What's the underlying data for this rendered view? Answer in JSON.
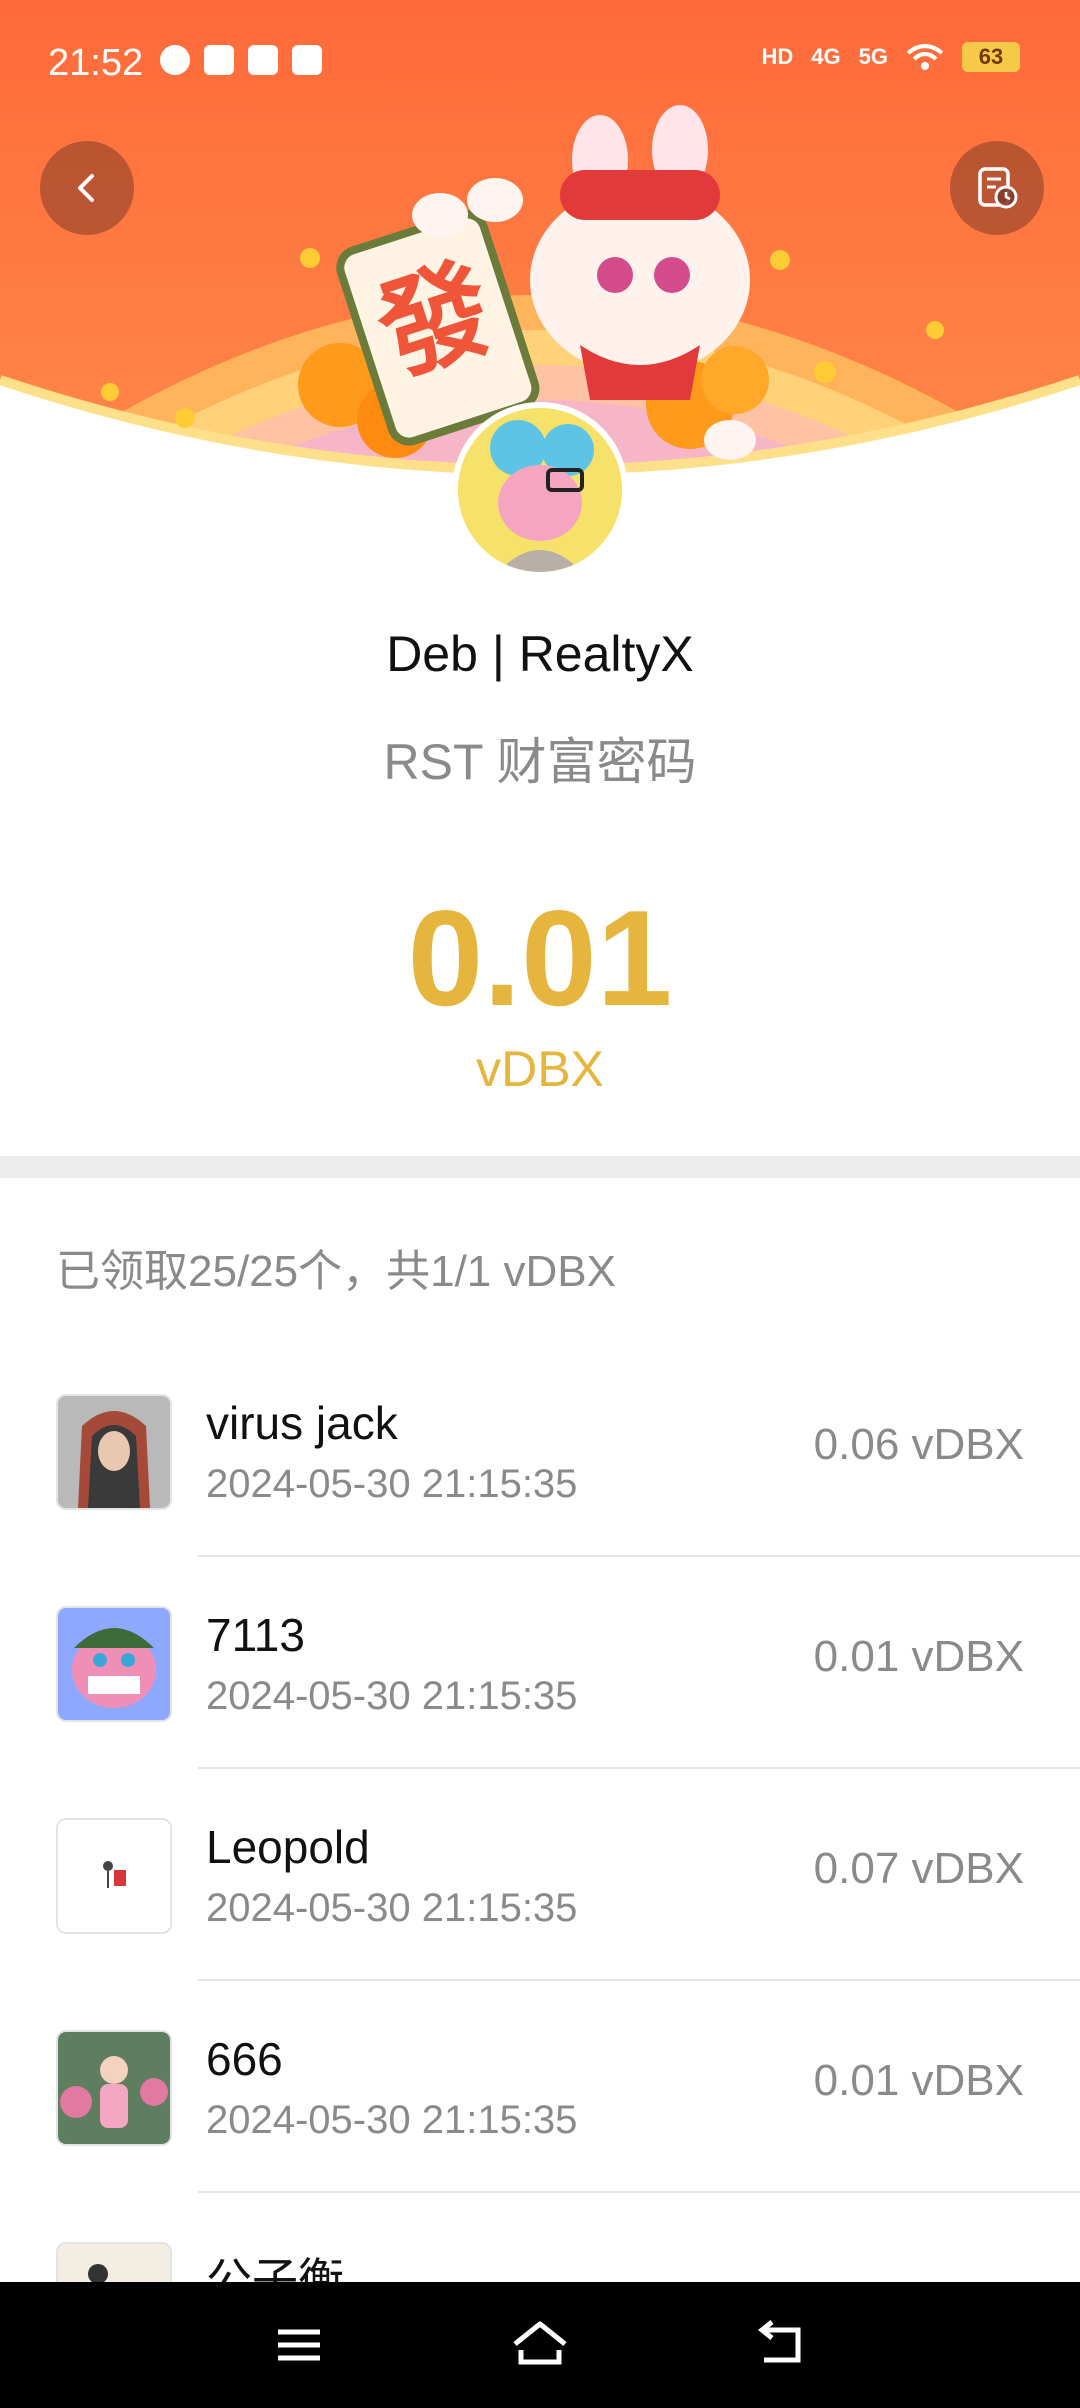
{
  "status_bar": {
    "time": "21:52",
    "signal_labels": [
      "HD",
      "4G",
      "5G"
    ],
    "battery": "63"
  },
  "header": {
    "back_icon": "chevron-left-icon",
    "record_icon": "receipt-clock-icon",
    "banner_theme": "lunar-new-year-rabbit-fortune"
  },
  "packet": {
    "sender": "Deb | RealtyX",
    "message": "RST 财富密码",
    "amount": "0.01",
    "unit": "vDBX"
  },
  "summary": "已领取25/25个，共1/1 vDBX",
  "claims": [
    {
      "name": "virus jack",
      "time": "2024-05-30 21:15:35",
      "amount": "0.06 vDBX",
      "avatar_color": "#a54a38"
    },
    {
      "name": "7113",
      "time": "2024-05-30 21:15:35",
      "amount": "0.01 vDBX",
      "avatar_color": "#8fa8ff"
    },
    {
      "name": "Leopold",
      "time": "2024-05-30 21:15:35",
      "amount": "0.07 vDBX",
      "avatar_color": "#ffffff"
    },
    {
      "name": "666",
      "time": "2024-05-30 21:15:35",
      "amount": "0.01 vDBX",
      "avatar_color": "#6b8e6b"
    },
    {
      "name": "公子衡",
      "time": "",
      "amount": "",
      "avatar_color": "#f3ede2"
    }
  ],
  "colors": {
    "banner_top": "#ff6a3a",
    "accent_gold": "#e6b53e",
    "divider": "#ececec"
  }
}
